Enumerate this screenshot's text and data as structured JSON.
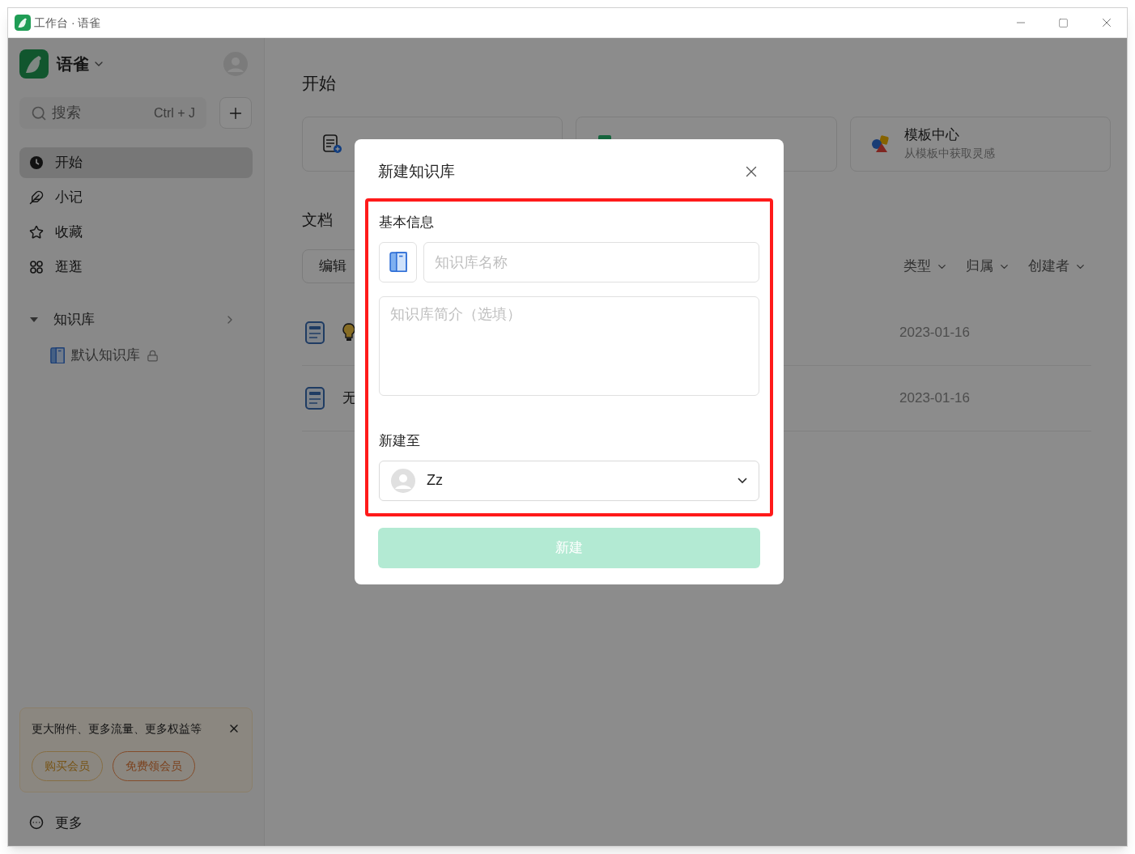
{
  "window": {
    "title": "工作台 · 语雀"
  },
  "sidebar": {
    "app_name": "语雀",
    "search": {
      "placeholder": "搜索",
      "shortcut": "Ctrl + J"
    },
    "nav": [
      {
        "label": "开始",
        "selected": true
      },
      {
        "label": "小记",
        "selected": false
      },
      {
        "label": "收藏",
        "selected": false
      },
      {
        "label": "逛逛",
        "selected": false
      }
    ],
    "section": {
      "label": "知识库",
      "expanded": true
    },
    "libraries": [
      {
        "name": "默认知识库",
        "locked": true
      }
    ],
    "promo": {
      "text": "更大附件、更多流量、更多权益等",
      "buttons": [
        "购买会员",
        "免费领会员"
      ]
    },
    "more": "更多"
  },
  "main": {
    "heading": "开始",
    "quick_actions": [
      {
        "kind": "document"
      },
      {
        "kind": "library"
      },
      {
        "kind": "template",
        "title": "模板中心",
        "subtitle": "从模板中获取灵感"
      }
    ],
    "docs_heading": "文档",
    "filter_button": "编辑",
    "filters": [
      "类型",
      "归属",
      "创建者"
    ],
    "rows": [
      {
        "date": "2023-01-16"
      },
      {
        "title": "无",
        "date": "2023-01-16"
      }
    ]
  },
  "modal": {
    "title": "新建知识库",
    "section_label": "基本信息",
    "name_placeholder": "知识库名称",
    "intro_placeholder": "知识库简介（选填）",
    "target_label": "新建至",
    "target_value": "Zz",
    "submit": "新建",
    "submit_disabled": true
  }
}
